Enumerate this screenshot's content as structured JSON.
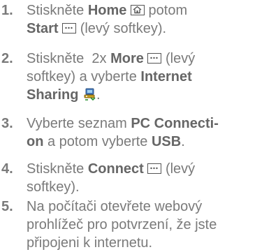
{
  "steps": [
    {
      "number": "1.",
      "line1_pre": "Stiskněte ",
      "line1_kw": "Home",
      "line1_post": " potom",
      "line2_kw": "Start",
      "line2_post": " (levý softkey)."
    },
    {
      "number": "2.",
      "line1_pre": "Stiskněte  2x ",
      "line1_kw": "More",
      "line1_post": " (levý",
      "line2_pre": "softkey) a vyberte ",
      "line2_kw": "Internet",
      "line3_kw": "Sharing"
    },
    {
      "number": "3.",
      "line1_pre": "Vyberte seznam ",
      "line1_kw": "PC Connecti-",
      "line2_kw": "on",
      "line2_mid": " a potom vyberte ",
      "line2_kw2": "USB",
      "line2_post": "."
    },
    {
      "number": "4.",
      "line1_pre": "Stiskněte ",
      "line1_kw": "Connect",
      "line1_post": " (levý",
      "line2_pre": "softkey)."
    },
    {
      "number": "5.",
      "line1_pre": "Na počítači otevřete webový",
      "line2_pre": "prohlížeč pro potvrzení, že jste",
      "line3_pre": "připojeni k internetu."
    }
  ],
  "icons": {
    "home": "home-key-icon",
    "softkey": "softkey-dots-icon",
    "sharing": "internet-sharing-icon"
  }
}
